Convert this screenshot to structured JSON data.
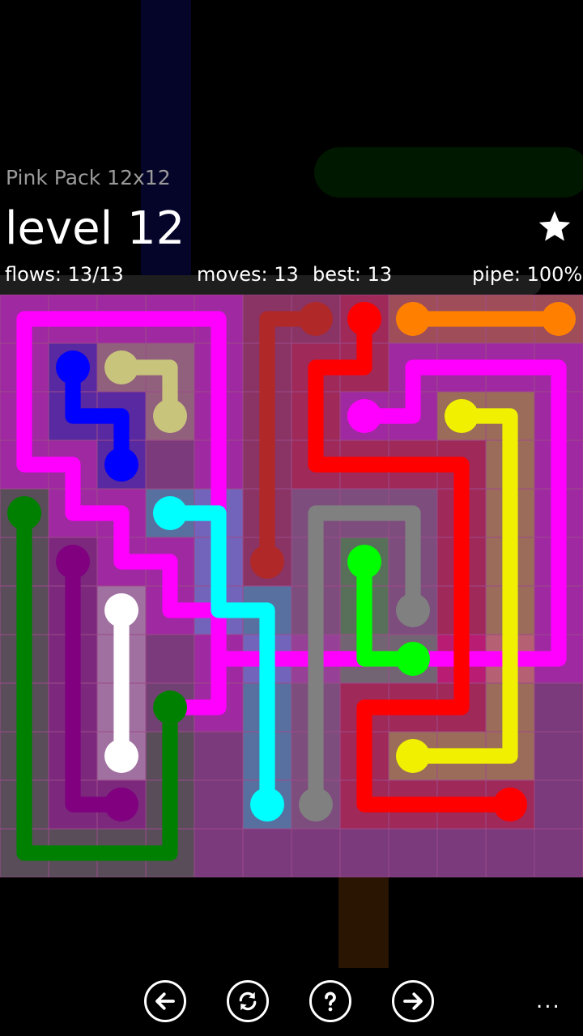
{
  "header": {
    "pack_title": "Pink Pack 12x12",
    "level_title": "level 12",
    "flows": "flows: 13/13",
    "moves": "moves: 13",
    "best": "best: 13",
    "pipe": "pipe: 100%",
    "star_icon": "star-icon"
  },
  "board": {
    "rows": 12,
    "cols": 12,
    "background_color": "#7a3a7c",
    "grid_line_color": "#9c4a8a",
    "flows": [
      {
        "name": "magenta",
        "color": "#ff00ff",
        "path": [
          [
            3,
            8
          ],
          [
            4,
            8
          ],
          [
            4,
            7
          ],
          [
            4,
            6
          ],
          [
            4,
            5
          ],
          [
            4,
            4
          ],
          [
            4,
            3
          ],
          [
            4,
            2
          ],
          [
            4,
            1
          ],
          [
            4,
            0
          ],
          [
            3,
            0
          ],
          [
            2,
            0
          ],
          [
            1,
            0
          ],
          [
            0,
            0
          ],
          [
            0,
            1
          ],
          [
            0,
            2
          ],
          [
            0,
            3
          ],
          [
            1,
            3
          ],
          [
            1,
            4
          ],
          [
            2,
            4
          ],
          [
            2,
            5
          ],
          [
            3,
            5
          ],
          [
            3,
            6
          ],
          [
            4,
            6
          ],
          [
            4,
            7
          ],
          [
            5,
            7
          ],
          [
            6,
            7
          ],
          [
            7,
            7
          ],
          [
            8,
            7
          ],
          [
            9,
            7
          ],
          [
            10,
            7
          ],
          [
            11,
            7
          ],
          [
            11,
            6
          ],
          [
            11,
            5
          ],
          [
            11,
            4
          ],
          [
            11,
            3
          ],
          [
            11,
            2
          ],
          [
            11,
            1
          ],
          [
            10,
            1
          ],
          [
            9,
            1
          ],
          [
            8,
            1
          ],
          [
            8,
            2
          ],
          [
            7,
            2
          ]
        ]
      },
      {
        "name": "blue",
        "color": "#0000ff",
        "path": [
          [
            1,
            1
          ],
          [
            1,
            2
          ],
          [
            2,
            2
          ],
          [
            2,
            3
          ]
        ]
      },
      {
        "name": "khaki",
        "color": "#c8c47c",
        "path": [
          [
            2,
            1
          ],
          [
            3,
            1
          ],
          [
            3,
            2
          ]
        ]
      },
      {
        "name": "darkred",
        "color": "#b02828",
        "path": [
          [
            6,
            0
          ],
          [
            5,
            0
          ],
          [
            5,
            1
          ],
          [
            5,
            2
          ],
          [
            5,
            3
          ],
          [
            5,
            4
          ],
          [
            5,
            5
          ]
        ]
      },
      {
        "name": "red",
        "color": "#ff0000",
        "path": [
          [
            7,
            0
          ],
          [
            7,
            1
          ],
          [
            6,
            1
          ],
          [
            6,
            2
          ],
          [
            6,
            3
          ],
          [
            7,
            3
          ],
          [
            8,
            3
          ],
          [
            9,
            3
          ],
          [
            9,
            4
          ],
          [
            9,
            5
          ],
          [
            9,
            6
          ],
          [
            9,
            7
          ],
          [
            9,
            8
          ],
          [
            8,
            8
          ],
          [
            7,
            8
          ],
          [
            7,
            9
          ],
          [
            7,
            10
          ],
          [
            8,
            10
          ],
          [
            9,
            10
          ],
          [
            10,
            10
          ]
        ]
      },
      {
        "name": "orange",
        "color": "#ff8000",
        "path": [
          [
            8,
            0
          ],
          [
            9,
            0
          ],
          [
            10,
            0
          ],
          [
            11,
            0
          ]
        ]
      },
      {
        "name": "yellow",
        "color": "#f0f000",
        "path": [
          [
            9,
            2
          ],
          [
            10,
            2
          ],
          [
            10,
            3
          ],
          [
            10,
            4
          ],
          [
            10,
            5
          ],
          [
            10,
            6
          ],
          [
            10,
            7
          ],
          [
            10,
            8
          ],
          [
            10,
            9
          ],
          [
            9,
            9
          ],
          [
            8,
            9
          ]
        ]
      },
      {
        "name": "green",
        "color": "#008000",
        "path": [
          [
            0,
            4
          ],
          [
            0,
            5
          ],
          [
            0,
            6
          ],
          [
            0,
            7
          ],
          [
            0,
            8
          ],
          [
            0,
            9
          ],
          [
            0,
            10
          ],
          [
            0,
            11
          ],
          [
            1,
            11
          ],
          [
            2,
            11
          ],
          [
            3,
            11
          ],
          [
            3,
            10
          ],
          [
            3,
            9
          ],
          [
            3,
            8
          ]
        ]
      },
      {
        "name": "cyan",
        "color": "#00ffff",
        "path": [
          [
            3,
            4
          ],
          [
            4,
            4
          ],
          [
            4,
            5
          ],
          [
            4,
            6
          ],
          [
            5,
            6
          ],
          [
            5,
            7
          ],
          [
            5,
            8
          ],
          [
            5,
            9
          ],
          [
            5,
            10
          ]
        ]
      },
      {
        "name": "gray",
        "color": "#808080",
        "path": [
          [
            6,
            10
          ],
          [
            6,
            9
          ],
          [
            6,
            8
          ],
          [
            6,
            7
          ],
          [
            6,
            6
          ],
          [
            6,
            5
          ],
          [
            6,
            4
          ],
          [
            7,
            4
          ],
          [
            8,
            4
          ],
          [
            8,
            5
          ],
          [
            8,
            6
          ]
        ]
      },
      {
        "name": "lime",
        "color": "#00ff00",
        "path": [
          [
            7,
            5
          ],
          [
            7,
            6
          ],
          [
            7,
            7
          ],
          [
            8,
            7
          ]
        ]
      },
      {
        "name": "purple",
        "color": "#800080",
        "path": [
          [
            1,
            5
          ],
          [
            1,
            6
          ],
          [
            1,
            7
          ],
          [
            1,
            8
          ],
          [
            1,
            9
          ],
          [
            1,
            10
          ],
          [
            2,
            10
          ]
        ]
      },
      {
        "name": "white",
        "color": "#ffffff",
        "path": [
          [
            2,
            6
          ],
          [
            2,
            7
          ],
          [
            2,
            8
          ],
          [
            2,
            9
          ]
        ]
      }
    ]
  },
  "footer": {
    "buttons": [
      {
        "name": "previous-level-button",
        "icon": "arrow-left-icon"
      },
      {
        "name": "restart-button",
        "icon": "refresh-icon"
      },
      {
        "name": "hint-button",
        "icon": "question-icon"
      },
      {
        "name": "next-level-button",
        "icon": "arrow-right-icon"
      }
    ],
    "more_label": "..."
  }
}
